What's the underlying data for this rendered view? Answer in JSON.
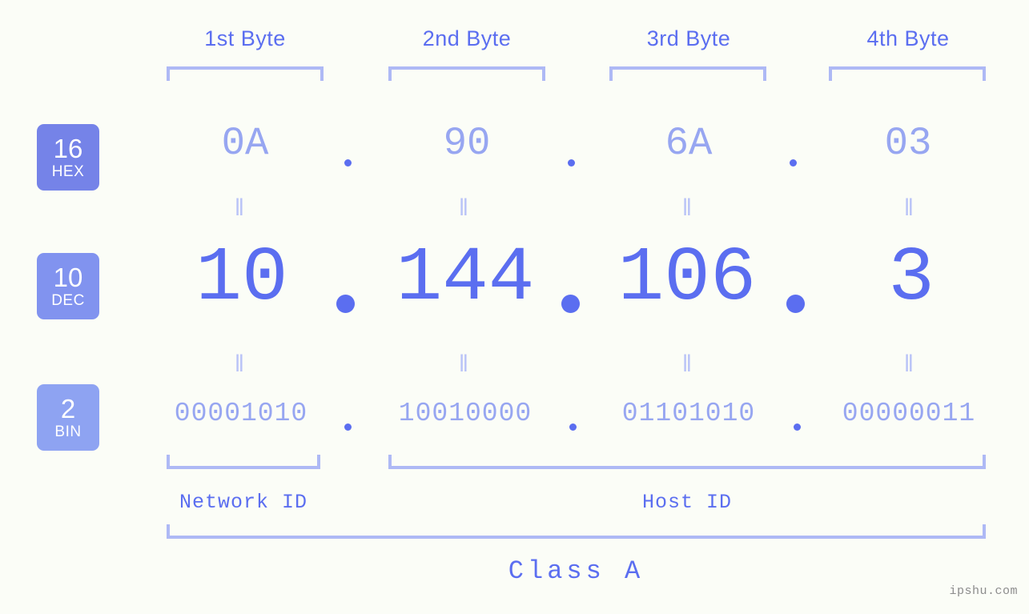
{
  "colors": {
    "background": "#fbfdf7",
    "primary": "#5b6ef0",
    "secondary": "#97a6f1",
    "bracket": "#aeb9f5",
    "badge_hex": "#7583e8",
    "badge_dec": "#8193ef",
    "badge_bin": "#8ea3f2",
    "watermark": "#8c8c8c"
  },
  "byte_headers": [
    {
      "label": "1st Byte"
    },
    {
      "label": "2nd Byte"
    },
    {
      "label": "3rd Byte"
    },
    {
      "label": "4th Byte"
    }
  ],
  "bases": [
    {
      "number": "16",
      "name": "HEX"
    },
    {
      "number": "10",
      "name": "DEC"
    },
    {
      "number": "2",
      "name": "BIN"
    }
  ],
  "rows": {
    "hex": {
      "base_number": "16",
      "base_name": "HEX",
      "octets": [
        "0A",
        "90",
        "6A",
        "03"
      ]
    },
    "dec": {
      "base_number": "10",
      "base_name": "DEC",
      "octets": [
        "10",
        "144",
        "106",
        "3"
      ]
    },
    "bin": {
      "base_number": "2",
      "base_name": "BIN",
      "octets": [
        "00001010",
        "10010000",
        "01101010",
        "00000011"
      ]
    }
  },
  "equality_marks": {
    "glyph": "‖"
  },
  "segments": {
    "network_id": "Network ID",
    "host_id": "Host ID",
    "class": "Class A"
  },
  "watermark": "ipshu.com",
  "ip_address": {
    "decimal": "10.144.106.3",
    "hex": "0A.90.6A.03",
    "binary": "00001010.10010000.01101010.00000011",
    "class": "Class A"
  }
}
